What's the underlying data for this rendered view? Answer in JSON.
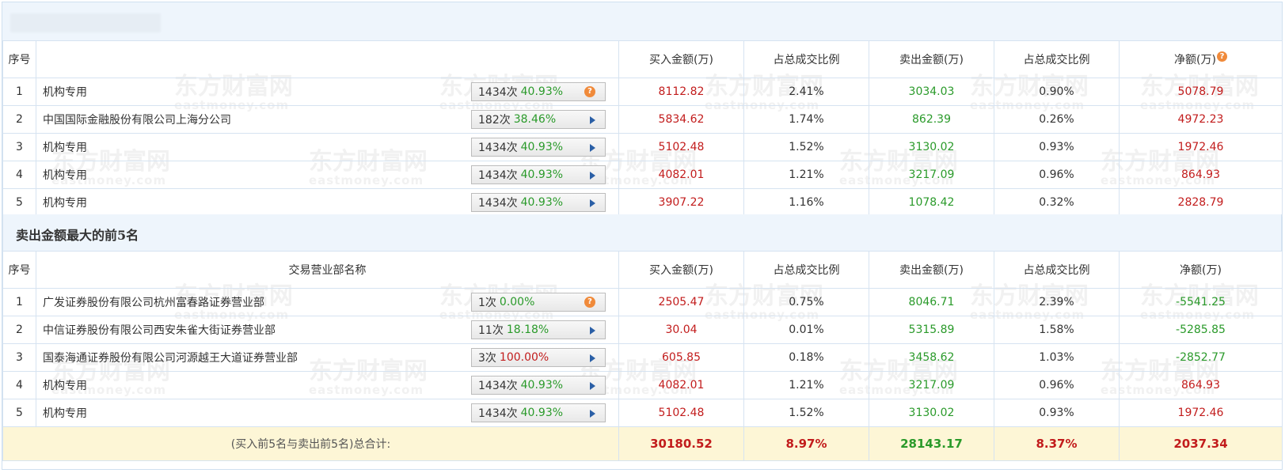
{
  "watermark": {
    "cn": "东方财富网",
    "en": "eastmoney.com"
  },
  "colors": {
    "positive": "#c21c1c",
    "negative": "#2a9a2a",
    "header_bg": "#eef5fc",
    "total_bg": "#fdf6d6"
  },
  "buy_table": {
    "headers": {
      "rank": "序号",
      "name": "",
      "buy": "买入金额(万)",
      "buy_ratio": "占总成交比例",
      "sell": "卖出金额(万)",
      "sell_ratio": "占总成交比例",
      "net": "净额(万)"
    },
    "rows": [
      {
        "rank": "1",
        "name": "机构专用",
        "count": "1434次",
        "pct": "40.93%",
        "pct_color": "green",
        "icon": "question-icon",
        "buy": "8112.82",
        "buy_ratio": "2.41%",
        "sell": "3034.03",
        "sell_ratio": "0.90%",
        "net": "5078.79",
        "net_sign": "pos"
      },
      {
        "rank": "2",
        "name": "中国国际金融股份有限公司上海分公司",
        "count": "182次",
        "pct": "38.46%",
        "pct_color": "green",
        "icon": "arrow-right-icon",
        "buy": "5834.62",
        "buy_ratio": "1.74%",
        "sell": "862.39",
        "sell_ratio": "0.26%",
        "net": "4972.23",
        "net_sign": "pos"
      },
      {
        "rank": "3",
        "name": "机构专用",
        "count": "1434次",
        "pct": "40.93%",
        "pct_color": "green",
        "icon": "arrow-right-icon",
        "buy": "5102.48",
        "buy_ratio": "1.52%",
        "sell": "3130.02",
        "sell_ratio": "0.93%",
        "net": "1972.46",
        "net_sign": "pos"
      },
      {
        "rank": "4",
        "name": "机构专用",
        "count": "1434次",
        "pct": "40.93%",
        "pct_color": "green",
        "icon": "arrow-right-icon",
        "buy": "4082.01",
        "buy_ratio": "1.21%",
        "sell": "3217.09",
        "sell_ratio": "0.96%",
        "net": "864.93",
        "net_sign": "pos"
      },
      {
        "rank": "5",
        "name": "机构专用",
        "count": "1434次",
        "pct": "40.93%",
        "pct_color": "green",
        "icon": "arrow-right-icon",
        "buy": "3907.22",
        "buy_ratio": "1.16%",
        "sell": "1078.42",
        "sell_ratio": "0.32%",
        "net": "2828.79",
        "net_sign": "pos"
      }
    ]
  },
  "sell_section_title": "卖出金额最大的前5名",
  "sell_table": {
    "headers": {
      "rank": "序号",
      "name": "交易营业部名称",
      "buy": "买入金额(万)",
      "buy_ratio": "占总成交比例",
      "sell": "卖出金额(万)",
      "sell_ratio": "占总成交比例",
      "net": "净额(万)"
    },
    "rows": [
      {
        "rank": "1",
        "name": "广发证券股份有限公司杭州富春路证券营业部",
        "count": "1次",
        "pct": "0.00%",
        "pct_color": "green",
        "icon": "question-icon",
        "buy": "2505.47",
        "buy_ratio": "0.75%",
        "sell": "8046.71",
        "sell_ratio": "2.39%",
        "net": "-5541.25",
        "net_sign": "neg"
      },
      {
        "rank": "2",
        "name": "中信证券股份有限公司西安朱雀大街证券营业部",
        "count": "11次",
        "pct": "18.18%",
        "pct_color": "green",
        "icon": "arrow-right-icon",
        "buy": "30.04",
        "buy_ratio": "0.01%",
        "sell": "5315.89",
        "sell_ratio": "1.58%",
        "net": "-5285.85",
        "net_sign": "neg"
      },
      {
        "rank": "3",
        "name": "国泰海通证券股份有限公司河源越王大道证券营业部",
        "count": "3次",
        "pct": "100.00%",
        "pct_color": "red",
        "icon": "arrow-right-icon",
        "buy": "605.85",
        "buy_ratio": "0.18%",
        "sell": "3458.62",
        "sell_ratio": "1.03%",
        "net": "-2852.77",
        "net_sign": "neg"
      },
      {
        "rank": "4",
        "name": "机构专用",
        "count": "1434次",
        "pct": "40.93%",
        "pct_color": "green",
        "icon": "arrow-right-icon",
        "buy": "4082.01",
        "buy_ratio": "1.21%",
        "sell": "3217.09",
        "sell_ratio": "0.96%",
        "net": "864.93",
        "net_sign": "pos"
      },
      {
        "rank": "5",
        "name": "机构专用",
        "count": "1434次",
        "pct": "40.93%",
        "pct_color": "green",
        "icon": "arrow-right-icon",
        "buy": "5102.48",
        "buy_ratio": "1.52%",
        "sell": "3130.02",
        "sell_ratio": "0.93%",
        "net": "1972.46",
        "net_sign": "pos"
      }
    ]
  },
  "total": {
    "label": "(买入前5名与卖出前5名)总合计:",
    "buy": "30180.52",
    "buy_ratio": "8.97%",
    "sell": "28143.17",
    "sell_ratio": "8.37%",
    "net": "2037.34"
  }
}
